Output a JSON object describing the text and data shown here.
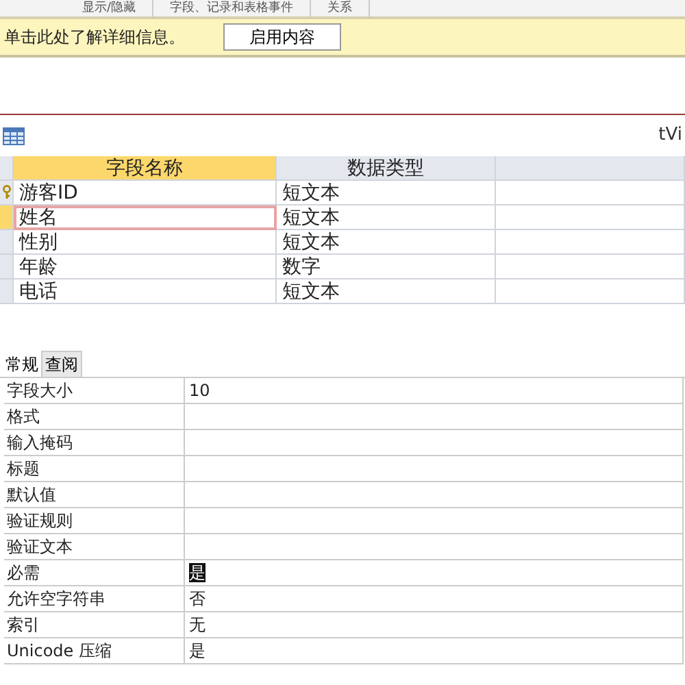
{
  "ribbon_groups": [
    "显示/隐藏",
    "字段、记录和表格事件",
    "关系"
  ],
  "message_bar": {
    "text": "单击此处了解详细信息。",
    "button": "启用内容"
  },
  "table_tab": {
    "title": "tVi"
  },
  "design_grid": {
    "columns": [
      "字段名称",
      "数据类型"
    ],
    "rows": [
      {
        "name": "游客ID",
        "type": "短文本",
        "primary_key": true,
        "selected": false
      },
      {
        "name": "姓名",
        "type": "短文本",
        "selected": true
      },
      {
        "name": "性别",
        "type": "短文本",
        "selected": false
      },
      {
        "name": "年龄",
        "type": "数字",
        "selected": false
      },
      {
        "name": "电话",
        "type": "短文本",
        "selected": false
      }
    ]
  },
  "property_tabs": [
    {
      "label": "常规",
      "selected": true
    },
    {
      "label": "查阅",
      "selected": false
    }
  ],
  "properties": [
    {
      "label": "字段大小",
      "value": "10"
    },
    {
      "label": "格式"
    },
    {
      "label": "输入掩码"
    },
    {
      "label": "标题"
    },
    {
      "label": "默认值"
    },
    {
      "label": "验证规则"
    },
    {
      "label": "验证文本"
    },
    {
      "label": "必需",
      "value": "是",
      "highlighted": true
    },
    {
      "label": "允许空字符串",
      "value": "否"
    },
    {
      "label": "索引",
      "value": "无"
    },
    {
      "label": "Unicode 压缩",
      "value": "是"
    }
  ]
}
